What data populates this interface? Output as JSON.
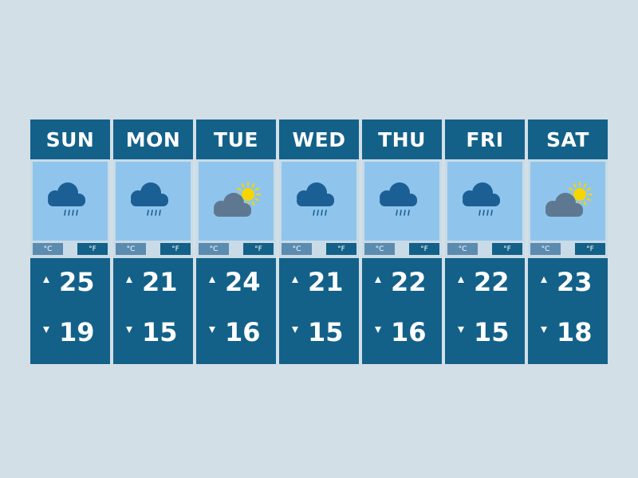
{
  "units": {
    "celsius": "°C",
    "fahrenheit": "°F"
  },
  "colors": {
    "background": "#d3dfe6",
    "header": "#136189",
    "sky": "#8fc5ec",
    "rain_cloud": "#1b5f95",
    "overcast_cloud": "#5f7891",
    "sun": "#f6d500"
  },
  "days": [
    {
      "name": "SUN",
      "icon": "rain-cloud-icon",
      "high": "25",
      "low": "19"
    },
    {
      "name": "MON",
      "icon": "rain-cloud-icon",
      "high": "21",
      "low": "15"
    },
    {
      "name": "TUE",
      "icon": "sun-behind-cloud-icon",
      "high": "24",
      "low": "16"
    },
    {
      "name": "WED",
      "icon": "rain-cloud-icon",
      "high": "21",
      "low": "15"
    },
    {
      "name": "THU",
      "icon": "rain-cloud-icon",
      "high": "22",
      "low": "16"
    },
    {
      "name": "FRI",
      "icon": "rain-cloud-icon",
      "high": "22",
      "low": "15"
    },
    {
      "name": "SAT",
      "icon": "sun-behind-cloud-icon",
      "high": "23",
      "low": "18"
    }
  ]
}
